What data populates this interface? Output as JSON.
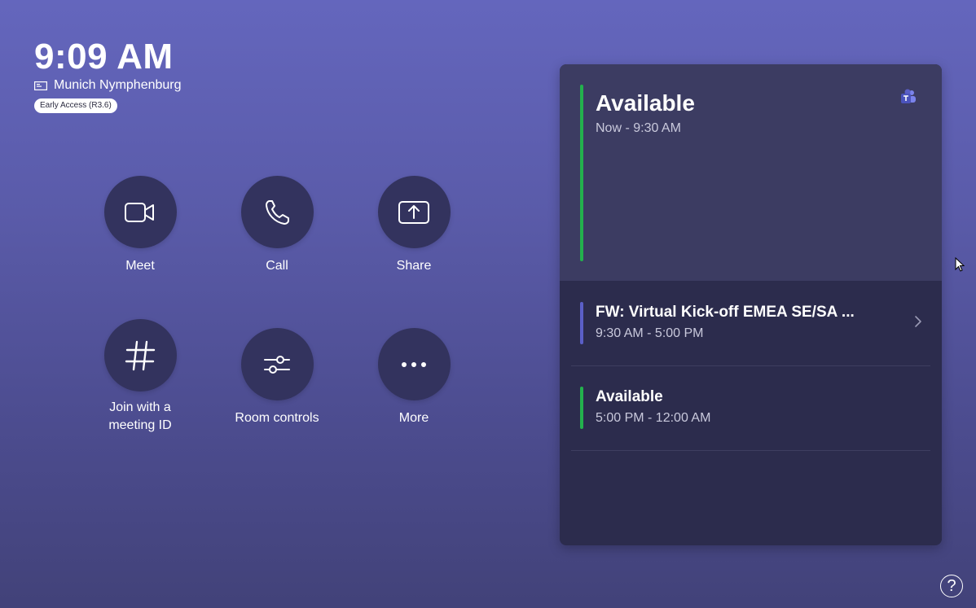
{
  "header": {
    "time": "9:09 AM",
    "room_name": "Munich Nymphenburg",
    "badge": "Early Access (R3.6)"
  },
  "actions": [
    {
      "label": "Meet",
      "icon": "video-camera-icon"
    },
    {
      "label": "Call",
      "icon": "phone-icon"
    },
    {
      "label": "Share",
      "icon": "share-screen-icon"
    },
    {
      "label": "Join with a meeting ID",
      "icon": "hash-icon"
    },
    {
      "label": "Room controls",
      "icon": "sliders-icon"
    },
    {
      "label": "More",
      "icon": "more-icon"
    }
  ],
  "calendar": {
    "current": {
      "title": "Available",
      "time": "Now - 9:30 AM",
      "status_color": "#23b14d"
    },
    "items": [
      {
        "title": "FW: Virtual Kick-off EMEA SE/SA ...",
        "time": "9:30 AM - 5:00 PM",
        "color": "#5b5fc7"
      },
      {
        "title": "Available",
        "time": "5:00 PM - 12:00 AM",
        "color": "#23b14d"
      }
    ]
  },
  "help": {
    "label": "?"
  }
}
